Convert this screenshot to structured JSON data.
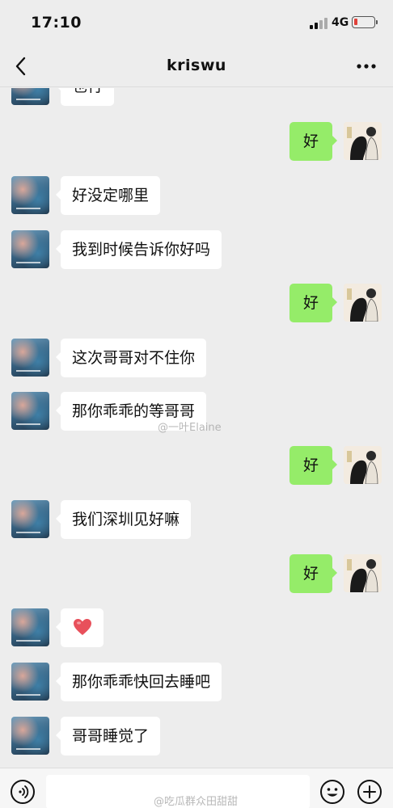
{
  "status_bar": {
    "time": "17:10",
    "network": "4G",
    "icons": [
      "signal-icon",
      "battery-icon"
    ],
    "battery_color": "#e0413a"
  },
  "header": {
    "title": "kriswu",
    "icons": [
      "back-icon",
      "more-icon"
    ]
  },
  "messages": [
    {
      "side": "in",
      "text": "也行"
    },
    {
      "side": "out",
      "text": "好"
    },
    {
      "side": "in",
      "text": "好没定哪里"
    },
    {
      "side": "in",
      "text": "我到时候告诉你好吗"
    },
    {
      "side": "out",
      "text": "好"
    },
    {
      "side": "in",
      "text": "这次哥哥对不住你"
    },
    {
      "side": "in",
      "text": "那你乖乖的等哥哥"
    },
    {
      "side": "out",
      "text": "好"
    },
    {
      "side": "in",
      "text": "我们深圳见好嘛"
    },
    {
      "side": "out",
      "text": "好"
    },
    {
      "side": "in",
      "text": "",
      "emoji": "heart-icon"
    },
    {
      "side": "in",
      "text": "那你乖乖快回去睡吧"
    },
    {
      "side": "in",
      "text": "哥哥睡觉了"
    }
  ],
  "watermarks": [
    "@一叶Elaine",
    "@吃瓜群众田甜甜"
  ],
  "input_bar": {
    "value": "",
    "icons": [
      "voice-icon",
      "emoji-icon",
      "plus-icon"
    ]
  },
  "colors": {
    "background": "#ededed",
    "outgoing_bubble": "#95ec69",
    "incoming_bubble": "#ffffff",
    "heart": "#e8505b"
  }
}
